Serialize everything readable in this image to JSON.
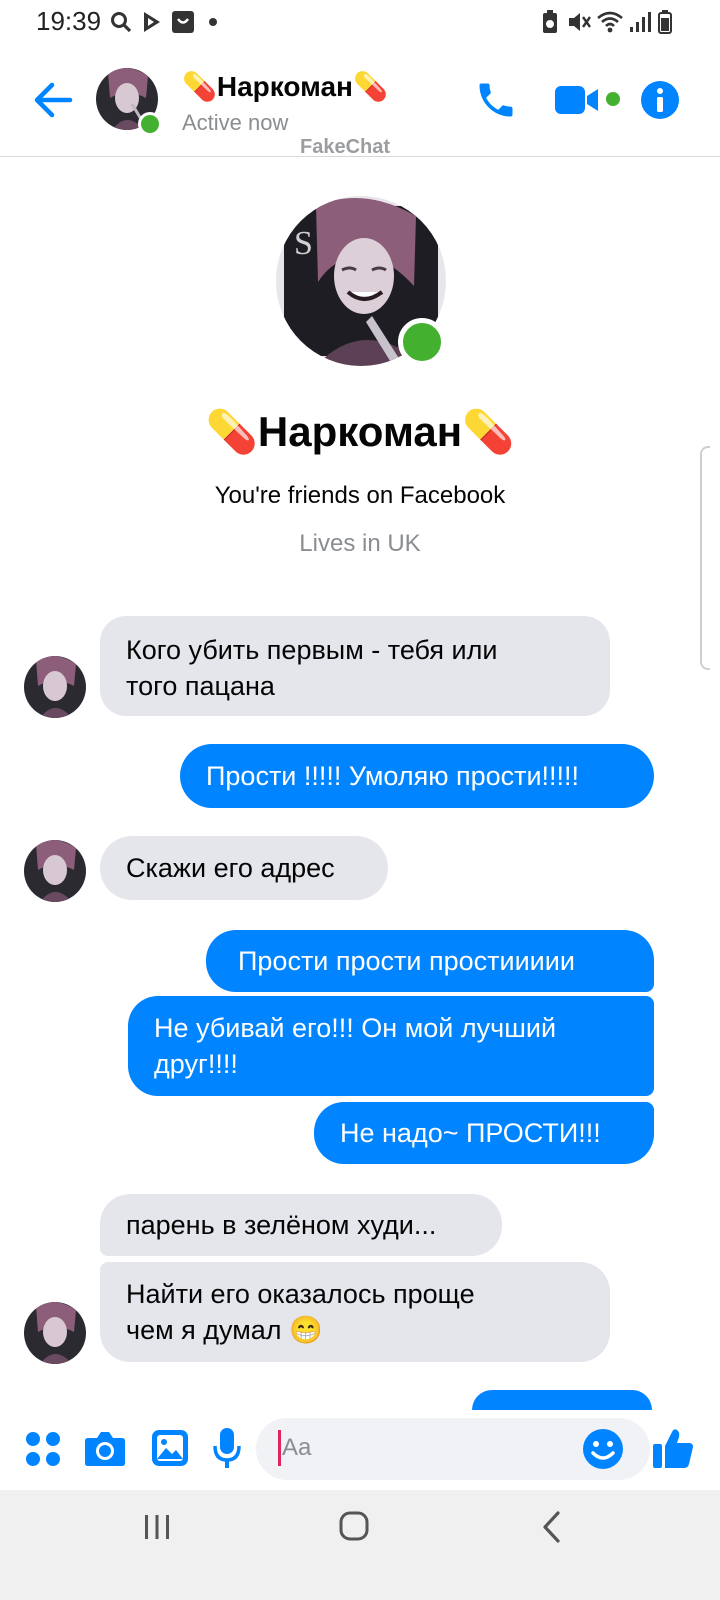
{
  "status_bar": {
    "time": "19:39",
    "left_icons": [
      "search-icon",
      "play-store-icon",
      "app-icon",
      "dot-icon"
    ],
    "right_icons": [
      "battery-saver-icon",
      "mute-icon",
      "wifi-icon",
      "signal-icon",
      "battery-icon"
    ]
  },
  "header": {
    "back_icon": "arrow-left-icon",
    "name": "💊Наркоман💊",
    "status": "Active now",
    "watermark": "FakeChat",
    "actions": [
      "phone-icon",
      "video-camera-icon",
      "info-icon"
    ],
    "accent": "#0084ff",
    "online_color": "#44b030"
  },
  "profile": {
    "name": "💊Наркоман💊",
    "friends_line": "You're friends on Facebook",
    "lives_line": "Lives in UK"
  },
  "messages": [
    {
      "from": "them",
      "lines": [
        "Кого убить первым - тебя или",
        "того пацана"
      ]
    },
    {
      "from": "me",
      "lines": [
        "Прости !!!!! Умоляю прости!!!!!"
      ]
    },
    {
      "from": "them",
      "lines": [
        "Скажи его адрес"
      ]
    },
    {
      "from": "me",
      "lines": [
        "Прости прости простиииии"
      ]
    },
    {
      "from": "me",
      "lines": [
        "Не убивай его!!! Он мой лучший",
        "друг!!!!"
      ]
    },
    {
      "from": "me",
      "lines": [
        "Не надо~ ПРОСТИ!!!"
      ]
    },
    {
      "from": "them",
      "lines": [
        "парень в зелёном худи..."
      ]
    },
    {
      "from": "them",
      "lines": [
        "Найти его оказалось проще",
        "чем я думал 😁"
      ]
    }
  ],
  "composer": {
    "placeholder": "Aa",
    "left_icons": [
      "apps-icon",
      "camera-icon",
      "gallery-icon",
      "microphone-icon"
    ],
    "emoji_icon": "smiley-icon",
    "like_icon": "thumbs-up-icon"
  },
  "navbar": {
    "icons": [
      "recent-apps-icon",
      "home-icon",
      "back-icon"
    ]
  }
}
